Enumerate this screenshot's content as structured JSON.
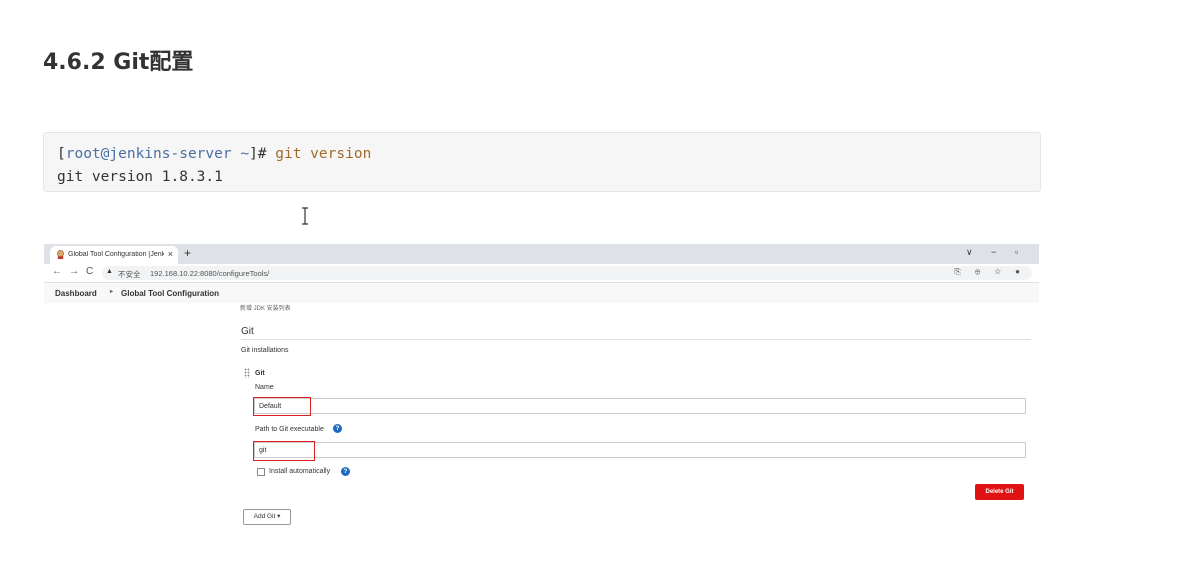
{
  "heading": "4.6.2 Git配置",
  "code": {
    "line1_bracket_open": "[",
    "line1_user": "root@jenkins-server ~",
    "line1_bracket_close": "]# ",
    "line1_cmd": "git version",
    "line2": "git version 1.8.3.1"
  },
  "browser": {
    "tab_title": "Global Tool Configuration [Jenkins]",
    "tab_close": "×",
    "new_tab": "+",
    "win_min": "∨",
    "win_dash": "−",
    "win_restore": "▫",
    "back": "←",
    "forward": "→",
    "reload": "C",
    "warn": "▲",
    "insecure_label": "不安全",
    "url": "192.168.10.22:8080/configureTools/",
    "url_icons": "⎘ ⊕ ☆ ●"
  },
  "breadcrumb": {
    "item1": "Dashboard",
    "sep": "▸",
    "item2": "Global Tool Configuration"
  },
  "git_section": {
    "cut_text": "新增 JDK 安装列表",
    "title": "Git",
    "installations_label": "Git installations",
    "item_title": "Git",
    "name_label": "Name",
    "name_value": "Default",
    "path_label": "Path to Git executable",
    "path_value": "git",
    "help": "?",
    "install_auto_label": "Install automatically",
    "delete_button": "Delete Git",
    "add_button": "Add Git ▾"
  },
  "colors": {
    "highlight": "#e02020",
    "delete_button": "#e01212",
    "help_icon": "#1e6bc6"
  }
}
